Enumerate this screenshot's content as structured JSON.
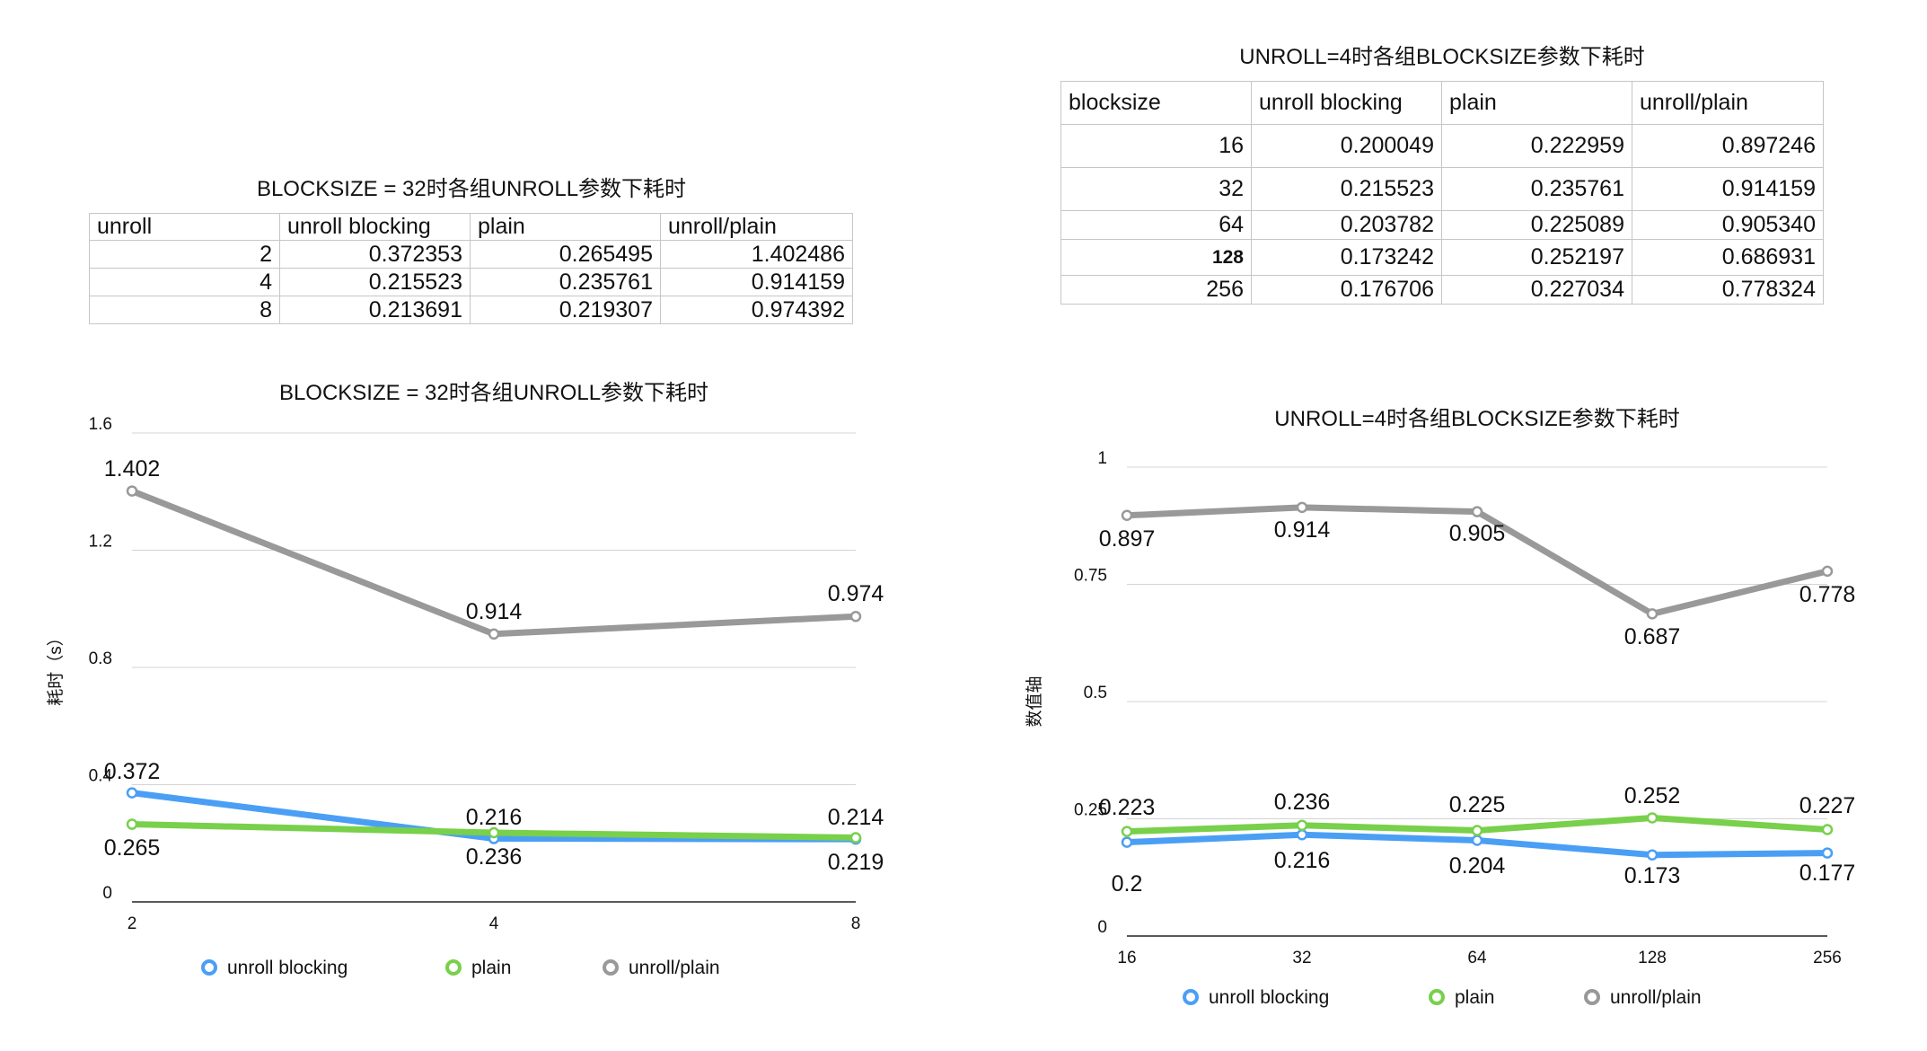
{
  "table1": {
    "title": "BLOCKSIZE = 32时各组UNROLL参数下耗时",
    "header": [
      "unroll",
      "unroll blocking",
      "plain",
      "unroll/plain"
    ],
    "rows": [
      [
        "2",
        "0.372353",
        "0.265495",
        "1.402486"
      ],
      [
        "4",
        "0.215523",
        "0.235761",
        "0.914159"
      ],
      [
        "8",
        "0.213691",
        "0.219307",
        "0.974392"
      ]
    ]
  },
  "table2": {
    "title": "UNROLL=4时各组BLOCKSIZE参数下耗时",
    "header": [
      "blocksize",
      "unroll blocking",
      "plain",
      "unroll/plain"
    ],
    "rows": [
      [
        "16",
        "0.200049",
        "0.222959",
        "0.897246"
      ],
      [
        "32",
        "0.215523",
        "0.235761",
        "0.914159"
      ],
      [
        "64",
        "0.203782",
        "0.225089",
        "0.905340"
      ],
      [
        "128",
        "0.173242",
        "0.252197",
        "0.686931"
      ],
      [
        "256",
        "0.176706",
        "0.227034",
        "0.778324"
      ]
    ]
  },
  "colors": {
    "unroll_blocking": "#4a9ff5",
    "plain": "#78d04b",
    "unroll_plain": "#999999"
  },
  "chart_data": [
    {
      "type": "line",
      "title": "BLOCKSIZE = 32时各组UNROLL参数下耗时",
      "xlabel": "",
      "ylabel": "耗时（s）",
      "categories": [
        "2",
        "4",
        "8"
      ],
      "yticks": [
        "0",
        "0.4",
        "0.8",
        "1.2",
        "1.6"
      ],
      "ylim": [
        0,
        1.6
      ],
      "grid": true,
      "legend": "bottom",
      "series": [
        {
          "name": "unroll blocking",
          "values": [
            0.372,
            0.216,
            0.214
          ],
          "labels": [
            "0.372",
            "0.236",
            "0.219"
          ]
        },
        {
          "name": "plain",
          "values": [
            0.265,
            0.236,
            0.219
          ],
          "labels": [
            "0.265",
            "0.216",
            "0.214"
          ]
        },
        {
          "name": "unroll/plain",
          "values": [
            1.402,
            0.914,
            0.974
          ],
          "labels": [
            "1.402",
            "0.914",
            "0.974"
          ]
        }
      ]
    },
    {
      "type": "line",
      "title": "UNROLL=4时各组BLOCKSIZE参数下耗时",
      "xlabel": "",
      "ylabel": "数值轴",
      "categories": [
        "16",
        "32",
        "64",
        "128",
        "256"
      ],
      "yticks": [
        "0",
        "0.25",
        "0.5",
        "0.75",
        "1"
      ],
      "ylim": [
        0,
        1
      ],
      "grid": true,
      "legend": "bottom",
      "series": [
        {
          "name": "unroll blocking",
          "values": [
            0.2,
            0.216,
            0.204,
            0.173,
            0.177
          ],
          "labels": [
            "0.2",
            "0.216",
            "0.204",
            "0.173",
            "0.177"
          ]
        },
        {
          "name": "plain",
          "values": [
            0.223,
            0.236,
            0.225,
            0.252,
            0.227
          ],
          "labels": [
            "0.223",
            "0.236",
            "0.225",
            "0.252",
            "0.227"
          ]
        },
        {
          "name": "unroll/plain",
          "values": [
            0.897,
            0.914,
            0.905,
            0.687,
            0.778
          ],
          "labels": [
            "0.897",
            "0.914",
            "0.905",
            "0.687",
            "0.778"
          ]
        }
      ]
    }
  ]
}
